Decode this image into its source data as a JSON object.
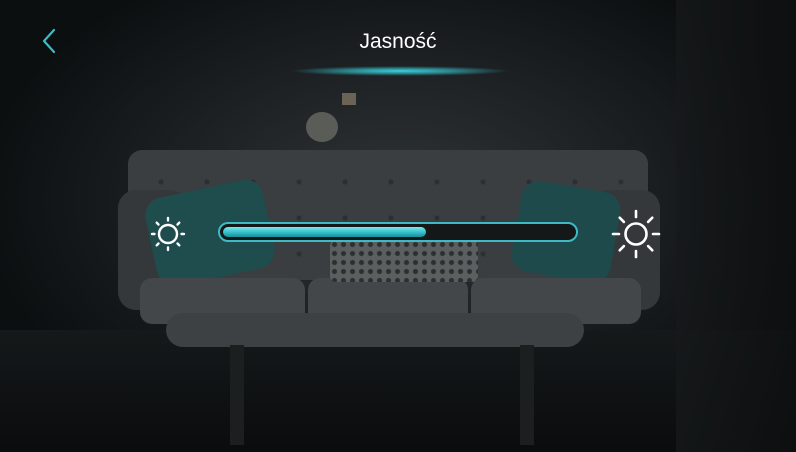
{
  "header": {
    "title": "Jasność",
    "back_icon": "chevron-left-icon"
  },
  "brightness": {
    "value_percent": 58,
    "min_icon": "sun-small-icon",
    "max_icon": "sun-large-icon"
  },
  "colors": {
    "accent": "#3ebac4",
    "fill_light": "#7be8ee",
    "text": "#ffffff"
  }
}
